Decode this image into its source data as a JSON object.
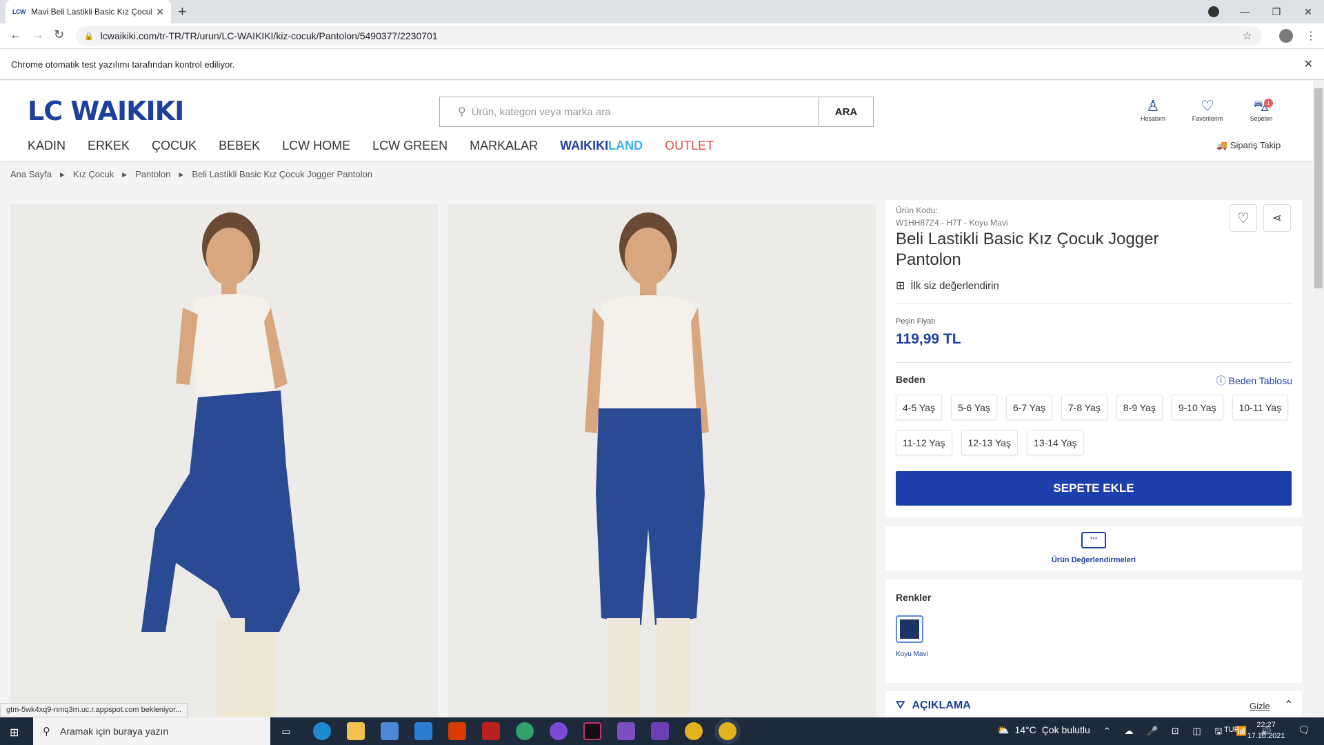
{
  "browser": {
    "tab_title": "Mavi Beli Lastikli Basic Kız Çocuk",
    "tab_favicon": "LCW",
    "url": "lcwaikiki.com/tr-TR/TR/urun/LC-WAIKIKI/kiz-cocuk/Pantolon/5490377/2230701",
    "infobar_text": "Chrome otomatik test yazılımı tarafından kontrol ediliyor.",
    "status_text": "gtm-5wk4xq9-nmq3m.uc.r.appspot.com bekleniyor..."
  },
  "site": {
    "logo": "LC WAIKIKI",
    "search_placeholder": "Ürün, kategori veya marka ara",
    "search_button": "ARA",
    "account_label": "Hesabım",
    "favorites_label": "Favorilerim",
    "cart_label": "Sepetim",
    "cart_count": "1",
    "nav": [
      "KADIN",
      "ERKEK",
      "ÇOCUK",
      "BEBEK",
      "LCW HOME",
      "LCW GREEN",
      "MARKALAR"
    ],
    "nav_waikiki_a": "WAIKIKI",
    "nav_waikiki_b": "LAND",
    "nav_outlet": "OUTLET",
    "order_tracking": "Sipariş Takip",
    "accent_color": "#1d3f9e"
  },
  "breadcrumb": [
    "Ana Sayfa",
    "Kız Çocuk",
    "Pantolon",
    "Beli Lastikli Basic Kız Çocuk Jogger Pantolon"
  ],
  "product": {
    "code_label": "Ürün Kodu:",
    "code": "W1HH87Z4 - H7T - Koyu Mavi",
    "title": "Beli Lastikli Basic Kız Çocuk Jogger Pantolon",
    "review_prompt": "İlk siz değerlendirin",
    "price_label": "Peşin Fiyatı",
    "price": "119,99 TL",
    "size_label": "Beden",
    "size_chart": "Beden Tablosu",
    "sizes_row1": [
      "4-5 Yaş",
      "5-6 Yaş",
      "6-7 Yaş",
      "7-8 Yaş",
      "8-9 Yaş",
      "9-10 Yaş",
      "10-11 Yaş"
    ],
    "sizes_row2": [
      "11-12 Yaş",
      "12-13 Yaş",
      "13-14 Yaş"
    ],
    "add_to_cart": "SEPETE EKLE",
    "reviews_label": "Ürün Değerlendirmeleri",
    "reviews_icon_text": "***",
    "colors_label": "Renkler",
    "color_name": "Koyu Mavi",
    "color_hex": "#1c3466",
    "description_label": "AÇIKLAMA",
    "hide_label": "Gizle"
  },
  "taskbar": {
    "search_placeholder": "Aramak için buraya yazın",
    "weather_temp": "14°C",
    "weather_text": "Çok bulutlu",
    "language": "TUR",
    "time": "22:27",
    "date": "17.10.2021"
  }
}
